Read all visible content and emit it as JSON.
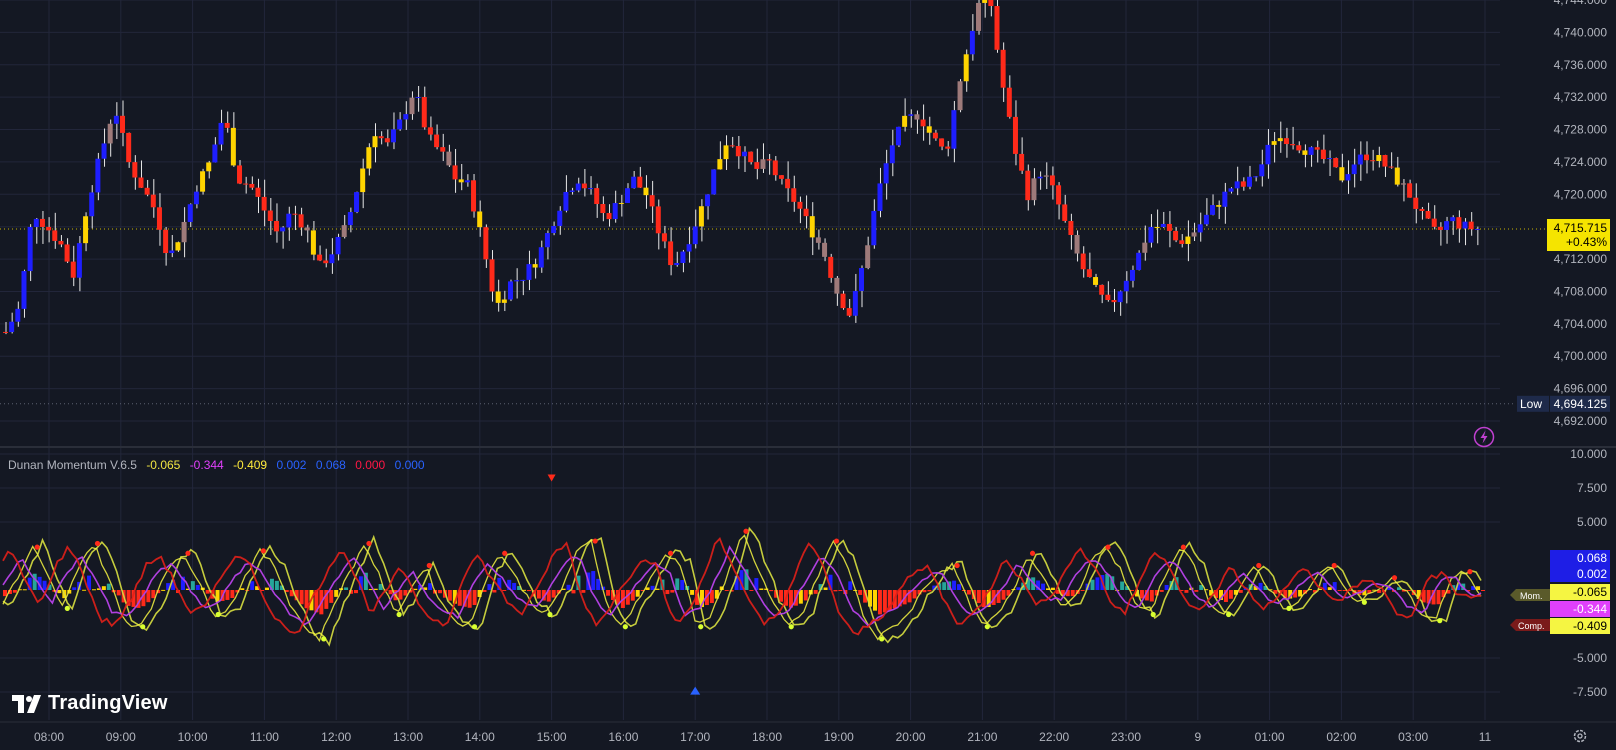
{
  "price_pane": {
    "y_ticks": [
      "4,744.000",
      "4,740.000",
      "4,736.000",
      "4,732.000",
      "4,728.000",
      "4,724.000",
      "4,720.000",
      "4,716.000",
      "4,712.000",
      "4,708.000",
      "4,704.000",
      "4,700.000",
      "4,696.000",
      "4,692.000"
    ],
    "y_values": [
      4744,
      4740,
      4736,
      4732,
      4728,
      4724,
      4720,
      4716,
      4712,
      4708,
      4704,
      4700,
      4696,
      4692
    ],
    "last_price_label": "4,715.715",
    "last_change_label": "+0.43%",
    "last_price": 4715.715,
    "low_label": "Low",
    "low_value_label": "4,694.125",
    "low_value": 4694.125
  },
  "indicator": {
    "name": "Dunan Momentum V.6.5",
    "values": [
      {
        "text": "-0.065",
        "color": "#f0e442"
      },
      {
        "text": "-0.344",
        "color": "#e040fb"
      },
      {
        "text": "-0.409",
        "color": "#ffeb3b"
      },
      {
        "text": "0.002",
        "color": "#2962ff"
      },
      {
        "text": "0.068",
        "color": "#2962ff"
      },
      {
        "text": "0.000",
        "color": "#ff1744"
      },
      {
        "text": "0.000",
        "color": "#2962ff"
      }
    ],
    "y_ticks": [
      "10.000",
      "7.500",
      "5.000",
      "-5.000",
      "-7.500"
    ],
    "y_values": [
      10,
      7.5,
      5,
      -5,
      -7.5
    ],
    "tags": [
      {
        "text": "0.068",
        "bg": "#1e1ee6",
        "fg": "#ffffff"
      },
      {
        "text": "0.002",
        "bg": "#1e1ee6",
        "fg": "#ffffff"
      },
      {
        "text": "-0.065",
        "bg": "#f5f542",
        "fg": "#000000"
      },
      {
        "text": "-0.344",
        "bg": "#e040fb",
        "fg": "#ffffff"
      },
      {
        "text": "-0.409",
        "bg": "#f5f542",
        "fg": "#000000"
      }
    ],
    "side_labels": [
      "Mom.",
      "Comp."
    ]
  },
  "x_axis": {
    "labels": [
      "08:00",
      "09:00",
      "10:00",
      "11:00",
      "12:00",
      "13:00",
      "14:00",
      "15:00",
      "16:00",
      "17:00",
      "18:00",
      "19:00",
      "20:00",
      "21:00",
      "22:00",
      "23:00",
      "9",
      "01:00",
      "02:00",
      "03:00",
      "11"
    ]
  },
  "branding": {
    "logo_text": "TradingView"
  },
  "colors": {
    "background": "#141823",
    "up": "#1e1eff",
    "down": "#ff2a1a",
    "warn": "#ffd400",
    "neutral": "#9e7a7a",
    "grid": "#22263a",
    "axis_text": "#b2b5be",
    "price_tag_bg": "#f5e400"
  },
  "chart_data": [
    {
      "type": "candlestick",
      "title": "",
      "ylim": [
        4690,
        4745
      ],
      "x_labels": [
        "08:00",
        "09:00",
        "10:00",
        "11:00",
        "12:00",
        "13:00",
        "14:00",
        "15:00",
        "16:00",
        "17:00",
        "18:00",
        "19:00",
        "20:00",
        "21:00",
        "22:00",
        "23:00",
        "9",
        "01:00",
        "02:00",
        "03:00",
        "11"
      ],
      "close_path": [
        4703,
        4706,
        4718,
        4716,
        4714,
        4710,
        4719,
        4725,
        4731,
        4724,
        4721,
        4718,
        4712,
        4716,
        4721,
        4724,
        4730,
        4722,
        4721,
        4718,
        4715,
        4718,
        4716,
        4711,
        4713,
        4716,
        4722,
        4728,
        4726,
        4729,
        4733,
        4727,
        4725,
        4722,
        4721,
        4714,
        4706,
        4709,
        4710,
        4712,
        4716,
        4720,
        4722,
        4720,
        4717,
        4719,
        4722,
        4720,
        4715,
        4711,
        4714,
        4718,
        4723,
        4727,
        4725,
        4723,
        4724,
        4721,
        4719,
        4716,
        4713,
        4708,
        4705,
        4712,
        4720,
        4726,
        4729,
        4730,
        4727,
        4725,
        4734,
        4741,
        4747,
        4735,
        4726,
        4720,
        4723,
        4720,
        4715,
        4711,
        4708,
        4706,
        4709,
        4712,
        4716,
        4716,
        4714,
        4715,
        4717,
        4719,
        4721,
        4721,
        4723,
        4727,
        4727,
        4726,
        4725,
        4724,
        4722,
        4724,
        4725,
        4724,
        4722,
        4720,
        4717,
        4715,
        4717,
        4716,
        4715.715
      ],
      "last_price": 4715.715,
      "low": 4694.125
    },
    {
      "type": "line",
      "title": "Dunan Momentum V.6.5",
      "ylim": [
        -9,
        10
      ],
      "series": [
        {
          "name": "Mom.",
          "last": -0.065
        },
        {
          "name": "Comp.",
          "last": -0.409
        }
      ],
      "oscillator_path": [
        -1,
        1,
        3.5,
        1,
        -1.5,
        2,
        3.8,
        1,
        -2.5,
        -3,
        -1,
        2,
        3,
        0.5,
        -2,
        -1.5,
        1,
        3.2,
        2,
        -1,
        -3,
        -4,
        -1,
        1.5,
        3.8,
        1,
        -2,
        0,
        2,
        -1,
        -2.5,
        -3,
        1,
        3,
        1,
        -1,
        -2,
        0,
        3,
        4,
        -1,
        -3,
        -1,
        1,
        3,
        2,
        -3,
        -2,
        1,
        4.8,
        2,
        -1,
        -3,
        -2,
        1,
        4,
        2,
        -2,
        -4,
        -3,
        -2,
        0,
        1.5,
        2,
        -1,
        -3,
        -2,
        0,
        3,
        1,
        -1,
        -1,
        2,
        3.5,
        2,
        -1,
        -2,
        1,
        3.5,
        2,
        -1,
        -2,
        0,
        2,
        0,
        -1.5,
        -1,
        1,
        2,
        0,
        -1,
        0,
        1,
        0,
        -2,
        -2.5,
        1,
        1.5,
        -0.5
      ],
      "triangles": [
        {
          "shape": "down",
          "x_label": "15:00",
          "y": 8.2
        },
        {
          "shape": "up",
          "x_label": "17:00",
          "y": -7.4
        }
      ]
    }
  ]
}
